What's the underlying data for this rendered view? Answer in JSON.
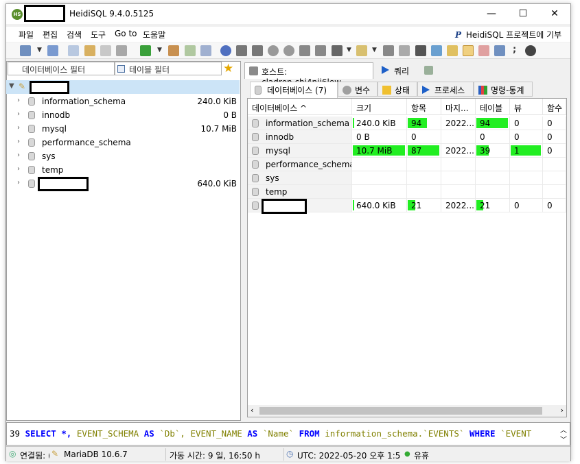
{
  "window": {
    "title": "HeidiSQL 9.4.0.5125",
    "minimize": "—",
    "maximize": "☐",
    "close": "✕"
  },
  "menu": {
    "items": [
      "파일",
      "편집",
      "검색",
      "도구",
      "Go to",
      "도움말"
    ],
    "promo": "HeidiSQL 프로젝트에 기부"
  },
  "left": {
    "db_filter": "데이터베이스 필터",
    "table_filter": "테이블 필터",
    "tree": [
      {
        "label": "information_schema",
        "size": "240.0 KiB"
      },
      {
        "label": "innodb",
        "size": "0 B"
      },
      {
        "label": "mysql",
        "size": "10.7 MiB"
      },
      {
        "label": "performance_schema",
        "size": ""
      },
      {
        "label": "sys",
        "size": ""
      },
      {
        "label": "temp",
        "size": ""
      },
      {
        "label": "",
        "size": "640.0 KiB"
      }
    ]
  },
  "right": {
    "tab_host": "호스트: cladren.chj4nii6lew...",
    "tab_query": "쿼리",
    "subtabs": [
      "데이터베이스 (7)",
      "변수",
      "상태",
      "프로세스",
      "명령-통계"
    ],
    "columns": [
      "데이터베이스 ^",
      "크기",
      "항목",
      "마지...",
      "테이블",
      "뷰",
      "함수"
    ],
    "rows": [
      {
        "name": "information_schema",
        "size": "240.0 KiB",
        "size_bar": 0.02,
        "items": "94",
        "items_bar": 0.6,
        "last": "2022...",
        "tables": "94",
        "tables_bar": 1.0,
        "views": "0",
        "views_bar": 0,
        "funcs": "0"
      },
      {
        "name": "innodb",
        "size": "0 B",
        "size_bar": 0,
        "items": "0",
        "items_bar": 0,
        "last": "",
        "tables": "0",
        "tables_bar": 0,
        "views": "0",
        "views_bar": 0,
        "funcs": "0"
      },
      {
        "name": "mysql",
        "size": "10.7 MiB",
        "size_bar": 1.0,
        "items": "87",
        "items_bar": 1.0,
        "last": "2022...",
        "tables": "39",
        "tables_bar": 0.4,
        "views": "1",
        "views_bar": 1.0,
        "funcs": "0"
      },
      {
        "name": "performance_schema",
        "size": "",
        "size_bar": 0,
        "items": "",
        "items_bar": 0,
        "last": "",
        "tables": "",
        "tables_bar": 0,
        "views": "",
        "views_bar": 0,
        "funcs": ""
      },
      {
        "name": "sys",
        "size": "",
        "size_bar": 0,
        "items": "",
        "items_bar": 0,
        "last": "",
        "tables": "",
        "tables_bar": 0,
        "views": "",
        "views_bar": 0,
        "funcs": ""
      },
      {
        "name": "temp",
        "size": "",
        "size_bar": 0,
        "items": "",
        "items_bar": 0,
        "last": "",
        "tables": "",
        "tables_bar": 0,
        "views": "",
        "views_bar": 0,
        "funcs": ""
      },
      {
        "name": "",
        "size": "640.0 KiB",
        "size_bar": 0.02,
        "items": "21",
        "items_bar": 0.24,
        "last": "2022...",
        "tables": "21",
        "tables_bar": 0.22,
        "views": "0",
        "views_bar": 0,
        "funcs": "0"
      }
    ]
  },
  "sql": {
    "line_no": "39",
    "segments": [
      {
        "t": "SELECT",
        "k": "kw"
      },
      {
        "t": " ",
        "k": ""
      },
      {
        "t": "*,",
        "k": "kw"
      },
      {
        "t": " ",
        "k": ""
      },
      {
        "t": "EVENT_SCHEMA",
        "k": "ident"
      },
      {
        "t": " ",
        "k": ""
      },
      {
        "t": "AS",
        "k": "kw"
      },
      {
        "t": " ",
        "k": ""
      },
      {
        "t": "`Db`,",
        "k": "ident"
      },
      {
        "t": " ",
        "k": ""
      },
      {
        "t": "EVENT_NAME",
        "k": "ident"
      },
      {
        "t": " ",
        "k": ""
      },
      {
        "t": "AS",
        "k": "kw"
      },
      {
        "t": " ",
        "k": ""
      },
      {
        "t": "`Name`",
        "k": "ident"
      },
      {
        "t": " ",
        "k": ""
      },
      {
        "t": "FROM",
        "k": "kw"
      },
      {
        "t": " ",
        "k": ""
      },
      {
        "t": "information_schema.`EVENTS`",
        "k": "ident"
      },
      {
        "t": " ",
        "k": ""
      },
      {
        "t": "WHERE",
        "k": "kw"
      },
      {
        "t": " ",
        "k": ""
      },
      {
        "t": "`EVENT",
        "k": "ident"
      }
    ]
  },
  "status": {
    "connected": "연결됨: (",
    "server": "MariaDB 10.6.7",
    "uptime": "가동 시간: 9 일, 16:50 h",
    "utc": "UTC: 2022-05-20 오후 1:5",
    "idle": "유휴"
  },
  "colors": {
    "bar_green": "#22ee22",
    "selection": "#cce4f7",
    "sql_keyword": "#0000ff",
    "sql_ident": "#808000"
  }
}
